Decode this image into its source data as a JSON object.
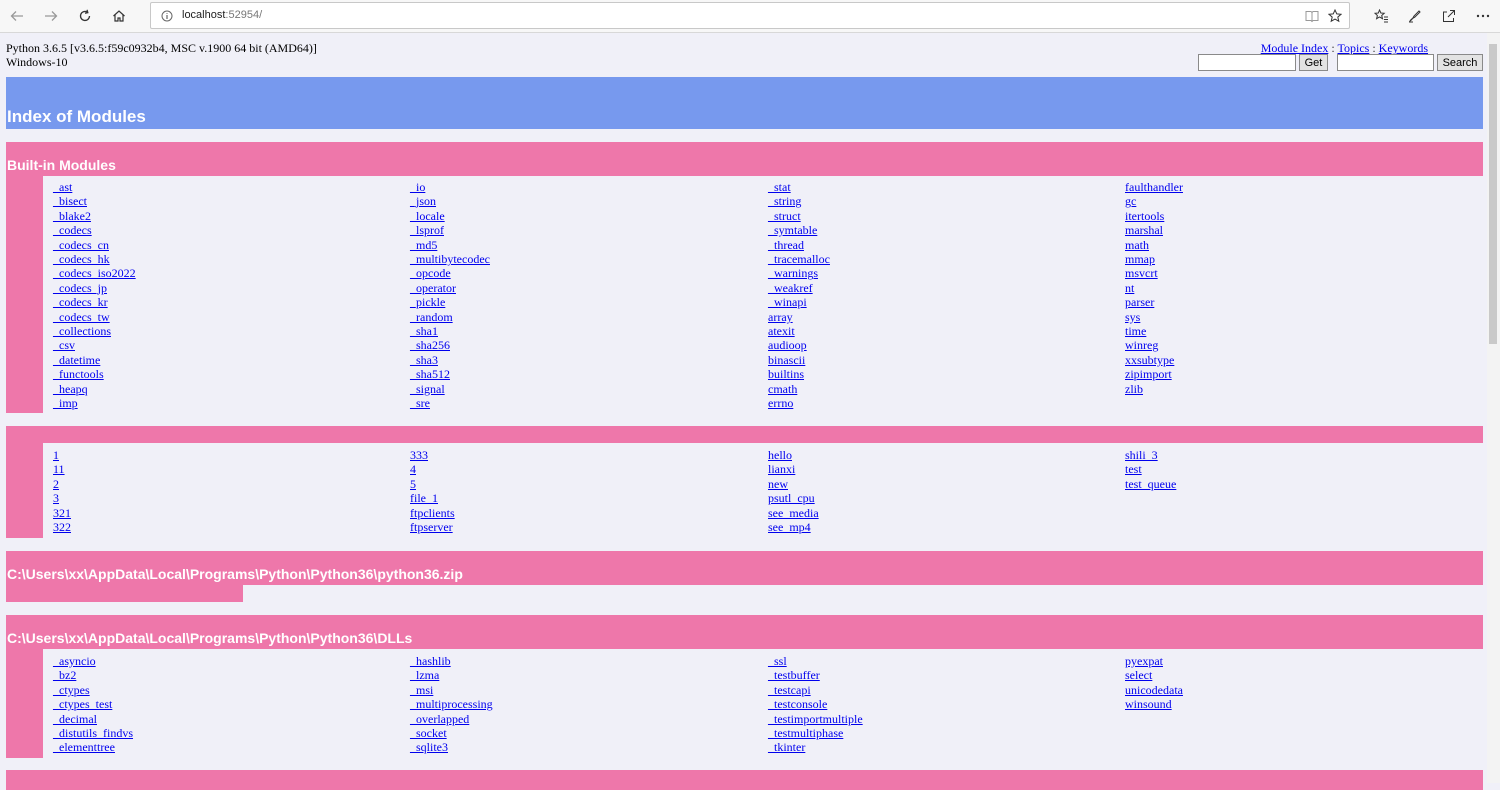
{
  "browser": {
    "url_host": "localhost",
    "url_port": ":52954/",
    "icons": [
      "back-icon",
      "forward-icon",
      "refresh-icon",
      "home-icon",
      "info-icon",
      "reading-view-icon",
      "favorite-star-icon",
      "favorites-hub-icon",
      "pen-icon",
      "share-icon",
      "more-icon"
    ]
  },
  "header": {
    "version_line1": "Python 3.6.5 [v3.6.5:f59c0932b4, MSC v.1900 64 bit (AMD64)]",
    "version_line2": "Windows-10",
    "links": {
      "module_index": "Module Index",
      "topics": "Topics",
      "keywords": "Keywords",
      "sep": " : "
    },
    "get_button": "Get",
    "search_button": "Search",
    "title": "Index of Modules"
  },
  "colors": {
    "heading": "#7799ee",
    "section": "#ee77aa",
    "background": "#f0f0f8",
    "link": "#0000ee"
  },
  "sections": {
    "builtin": {
      "title": "Built-in Modules",
      "col1": [
        "_ast",
        "_bisect",
        "_blake2",
        "_codecs",
        "_codecs_cn",
        "_codecs_hk",
        "_codecs_iso2022",
        "_codecs_jp",
        "_codecs_kr",
        "_codecs_tw",
        "_collections",
        "_csv",
        "_datetime",
        "_functools",
        "_heapq",
        "_imp"
      ],
      "col2": [
        "_io",
        "_json",
        "_locale",
        "_lsprof",
        "_md5",
        "_multibytecodec",
        "_opcode",
        "_operator",
        "_pickle",
        "_random",
        "_sha1",
        "_sha256",
        "_sha3",
        "_sha512",
        "_signal",
        "_sre"
      ],
      "col3": [
        "_stat",
        "_string",
        "_struct",
        "_symtable",
        "_thread",
        "_tracemalloc",
        "_warnings",
        "_weakref",
        "_winapi",
        "array",
        "atexit",
        "audioop",
        "binascii",
        "builtins",
        "cmath",
        "errno"
      ],
      "col4": [
        "faulthandler",
        "gc",
        "itertools",
        "marshal",
        "math",
        "mmap",
        "msvcrt",
        "nt",
        "parser",
        "sys",
        "time",
        "winreg",
        "xxsubtype",
        "zipimport",
        "zlib"
      ]
    },
    "local": {
      "title": "",
      "col1": [
        "1",
        "11",
        "2",
        "3",
        "321",
        "322"
      ],
      "col2": [
        "333",
        "4",
        "5",
        "file_1",
        "ftpclients",
        "ftpserver"
      ],
      "col3": [
        "hello",
        "lianxi",
        "new",
        "psutl_cpu",
        "see_media",
        "see_mp4"
      ],
      "col4": [
        "shili_3",
        "test",
        "test_queue"
      ]
    },
    "zip": {
      "title": "C:\\Users\\xx\\AppData\\Local\\Programs\\Python\\Python36\\python36.zip"
    },
    "dlls": {
      "title": "C:\\Users\\xx\\AppData\\Local\\Programs\\Python\\Python36\\DLLs",
      "col1": [
        "_asyncio",
        "_bz2",
        "_ctypes",
        "_ctypes_test",
        "_decimal",
        "_distutils_findvs",
        "_elementtree"
      ],
      "col2": [
        "_hashlib",
        "_lzma",
        "_msi",
        "_multiprocessing",
        "_overlapped",
        "_socket",
        "_sqlite3"
      ],
      "col3": [
        "_ssl",
        "_testbuffer",
        "_testcapi",
        "_testconsole",
        "_testimportmultiple",
        "_testmultiphase",
        "_tkinter"
      ],
      "col4": [
        "pyexpat",
        "select",
        "unicodedata",
        "winsound"
      ]
    }
  }
}
